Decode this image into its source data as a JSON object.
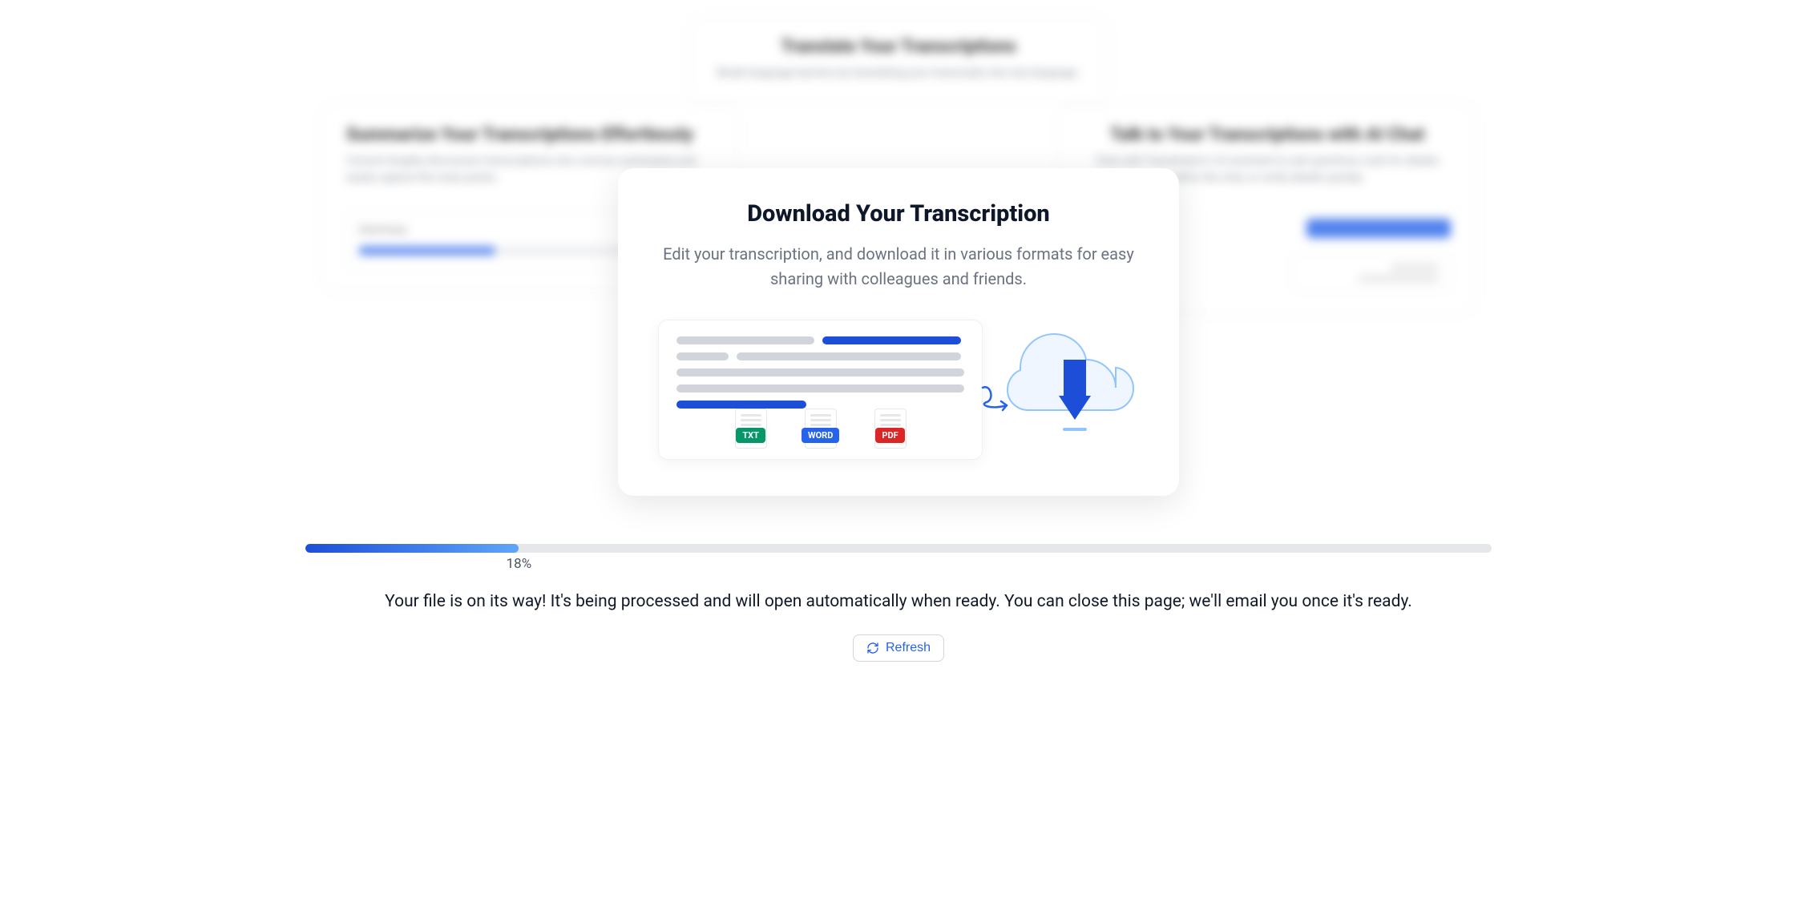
{
  "background_cards": {
    "top": {
      "title": "Translate Your Transcriptions",
      "desc": "Break language barriers by translating your transcripts into any language."
    },
    "left": {
      "title": "Summarize Your Transcriptions Effortlessly",
      "desc": "Convert lengthy discussion transcriptions into concise summaries and easily capture the main points.",
      "panel_label": "Summary"
    },
    "right": {
      "title": "Talk to Your Transcriptions with AI Chat",
      "desc": "Chat with Transkriptor's AI assistant to ask questions, look for details within the chat, or verify details quickly."
    }
  },
  "modal": {
    "title": "Download Your Transcription",
    "desc": "Edit your transcription, and download it in various formats for easy sharing with colleagues and friends.",
    "formats": {
      "txt": "TXT",
      "word": "WORD",
      "pdf": "PDF"
    }
  },
  "progress": {
    "percent": 18,
    "label": "18%"
  },
  "status_text": "Your file is on its way! It's being processed and will open automatically when ready. You can close this page; we'll email you once it's ready.",
  "refresh_label": "Refresh"
}
